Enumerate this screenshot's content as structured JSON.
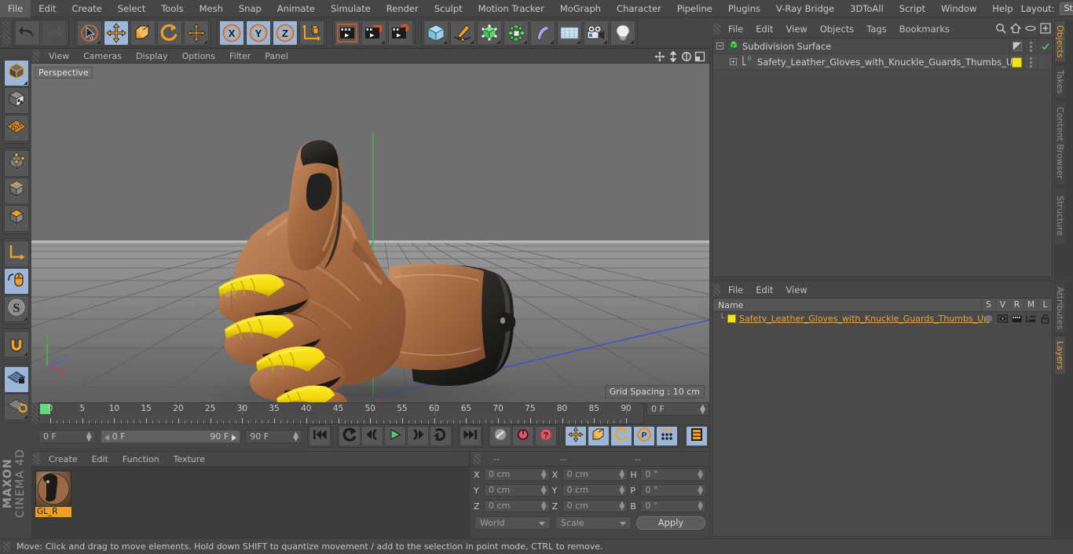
{
  "app": {
    "brand_top": "MAXON",
    "brand_bottom": "CINEMA 4D"
  },
  "menubar": {
    "items": [
      "File",
      "Edit",
      "Create",
      "Select",
      "Tools",
      "Mesh",
      "Snap",
      "Animate",
      "Simulate",
      "Render",
      "Sculpt",
      "Motion Tracker",
      "MoGraph",
      "Character",
      "Pipeline",
      "Plugins",
      "V-Ray Bridge",
      "3DToAll",
      "Script",
      "Window",
      "Help"
    ],
    "layout_label": "Layout:",
    "layout_value": "Startup",
    "search_icon": "magnifier-icon"
  },
  "toolbar": {
    "groups": [
      {
        "name": "history",
        "buttons": [
          {
            "icon": "undo-icon",
            "label": "Undo",
            "active": false,
            "disabled": false
          },
          {
            "icon": "redo-icon",
            "label": "Redo",
            "active": false,
            "disabled": true
          }
        ]
      },
      {
        "name": "transform",
        "buttons": [
          {
            "icon": "select-cursor-icon",
            "label": "Live Selection",
            "active": false
          },
          {
            "icon": "move-icon",
            "label": "Move",
            "active": true
          },
          {
            "icon": "scale-icon",
            "label": "Scale",
            "active": false
          },
          {
            "icon": "rotate-icon",
            "label": "Rotate",
            "active": false
          },
          {
            "icon": "move-dynamic-icon",
            "label": "Dynamic Place",
            "active": false
          }
        ]
      },
      {
        "name": "axis-locks",
        "buttons": [
          {
            "icon": "axis-x-icon",
            "label": "X",
            "active": true
          },
          {
            "icon": "axis-y-icon",
            "label": "Y",
            "active": true
          },
          {
            "icon": "axis-z-icon",
            "label": "Z",
            "active": true
          },
          {
            "icon": "world-object-axis-icon",
            "label": "World/Object",
            "active": false
          }
        ]
      },
      {
        "name": "render",
        "buttons": [
          {
            "icon": "render-view-icon",
            "label": "Render View",
            "active": false
          },
          {
            "icon": "render-picture-viewer-icon",
            "label": "Render to Picture Viewer",
            "active": false
          },
          {
            "icon": "render-settings-icon",
            "label": "Edit Render Settings",
            "active": false
          }
        ]
      },
      {
        "name": "create",
        "buttons": [
          {
            "icon": "cube-primitive-icon",
            "label": "Add Cube Object",
            "active": false
          },
          {
            "icon": "spline-pen-icon",
            "label": "Add Spline",
            "active": false
          },
          {
            "icon": "generator-icon",
            "label": "Add Generator",
            "active": false
          },
          {
            "icon": "mograph-icon",
            "label": "Add MoGraph",
            "active": false
          },
          {
            "icon": "deformer-icon",
            "label": "Add Deformer",
            "active": false
          },
          {
            "icon": "scene-environment-icon",
            "label": "Add Scene Object",
            "active": false
          },
          {
            "icon": "camera-icon",
            "label": "Add Camera",
            "active": false
          },
          {
            "icon": "light-bulb-icon",
            "label": "Add Light",
            "active": false
          }
        ]
      }
    ]
  },
  "left_toolbar": {
    "groups": [
      {
        "buttons": [
          {
            "icon": "editable-object-icon",
            "label": "Make Editable",
            "active": true
          },
          {
            "icon": "model-mode-icon",
            "label": "Model Mode",
            "active": false
          },
          {
            "icon": "texture-mode-icon",
            "label": "Texture Mode",
            "active": false
          }
        ]
      },
      {
        "buttons": [
          {
            "icon": "points-mode-icon",
            "label": "Points",
            "active": false
          },
          {
            "icon": "edges-mode-icon",
            "label": "Edges",
            "active": false
          },
          {
            "icon": "polygons-mode-icon",
            "label": "Polygons",
            "active": false
          }
        ]
      },
      {
        "buttons": [
          {
            "icon": "axis-modify-icon",
            "label": "Enable Axis Modification",
            "active": false
          },
          {
            "icon": "viewport-solo-icon",
            "label": "Viewport Solo",
            "active": true
          },
          {
            "icon": "soft-selection-icon",
            "label": "Soft Selection",
            "active": false
          }
        ]
      },
      {
        "buttons": [
          {
            "icon": "magnet-icon",
            "label": "Magnet",
            "active": false
          }
        ]
      },
      {
        "buttons": [
          {
            "icon": "workplane-lock-icon",
            "label": "Lock Workplane",
            "active": true
          },
          {
            "icon": "workplane-rotate-icon",
            "label": "Planar Workplane Rotation",
            "active": false
          }
        ]
      }
    ]
  },
  "viewport": {
    "menu": [
      "View",
      "Cameras",
      "Display",
      "Options",
      "Filter",
      "Panel"
    ],
    "nav_icons": [
      "move-camera-icon",
      "zoom-camera-icon",
      "rotate-camera-icon",
      "maximize-viewport-icon"
    ],
    "view_label": "Perspective",
    "grid_spacing": "Grid Spacing : 10 cm",
    "axis_gizmo": {
      "x": "X",
      "y": "Y",
      "z": "Z"
    }
  },
  "timeline": {
    "ticks": [
      {
        "v": "0",
        "f": 0
      },
      {
        "v": "5",
        "f": 5
      },
      {
        "v": "10",
        "f": 10
      },
      {
        "v": "15",
        "f": 15
      },
      {
        "v": "20",
        "f": 20
      },
      {
        "v": "25",
        "f": 25
      },
      {
        "v": "30",
        "f": 30
      },
      {
        "v": "35",
        "f": 35
      },
      {
        "v": "40",
        "f": 40
      },
      {
        "v": "45",
        "f": 45
      },
      {
        "v": "50",
        "f": 50
      },
      {
        "v": "55",
        "f": 55
      },
      {
        "v": "60",
        "f": 60
      },
      {
        "v": "65",
        "f": 65
      },
      {
        "v": "70",
        "f": 70
      },
      {
        "v": "75",
        "f": 75
      },
      {
        "v": "80",
        "f": 80
      },
      {
        "v": "85",
        "f": 85
      },
      {
        "v": "90",
        "f": 90
      }
    ],
    "current_frame_right": "0 F",
    "current_frame": "0 F",
    "range_start": "0 F",
    "range_end": "90 F",
    "max_frame": "90 F",
    "transport": [
      {
        "icon": "go-to-start-icon",
        "label": "Go to Start"
      },
      {
        "icon": "loop-icon",
        "label": "Play Mode / Loop"
      },
      {
        "icon": "step-back-icon",
        "label": "Previous Frame"
      },
      {
        "icon": "play-icon",
        "label": "Play Forward"
      },
      {
        "icon": "step-forward-icon",
        "label": "Next Frame"
      },
      {
        "icon": "goto-next-key-icon",
        "label": "Go to Next Key"
      },
      {
        "icon": "go-to-end-icon",
        "label": "Go to End"
      }
    ],
    "keyframe_tools": [
      {
        "icon": "record-key-grey-icon",
        "label": "Record Active Objects",
        "active": false
      },
      {
        "icon": "autokey-icon",
        "label": "Autokeying",
        "active": false
      },
      {
        "icon": "keyframe-selection-icon",
        "label": "Keyframe Selection",
        "active": false
      }
    ],
    "key_channels": [
      {
        "icon": "position-key-icon",
        "label": "Position",
        "active": true
      },
      {
        "icon": "scale-key-icon",
        "label": "Scale",
        "active": true
      },
      {
        "icon": "rotation-key-icon",
        "label": "Rotation",
        "active": true
      },
      {
        "icon": "param-key-icon",
        "label": "Parameter",
        "active": true
      },
      {
        "icon": "pla-key-icon",
        "label": "Point Level Animation",
        "active": true
      }
    ],
    "timeline_toggle": {
      "icon": "timeline-icon",
      "label": "Animate Mode",
      "active": true
    }
  },
  "materials": {
    "menu": [
      "Create",
      "Edit",
      "Function",
      "Texture"
    ],
    "items": [
      {
        "name": "GL_R",
        "selected": true
      }
    ]
  },
  "coordinates": {
    "header": [
      "--",
      "--",
      "--"
    ],
    "rows": [
      {
        "pos_label": "X",
        "pos_value": "0 cm",
        "size_label": "X",
        "size_value": "0 cm",
        "rot_label": "H",
        "rot_value": "0 °"
      },
      {
        "pos_label": "Y",
        "pos_value": "0 cm",
        "size_label": "Y",
        "size_value": "0 cm",
        "rot_label": "P",
        "rot_value": "0 °"
      },
      {
        "pos_label": "Z",
        "pos_value": "0 cm",
        "size_label": "Z",
        "size_value": "0 cm",
        "rot_label": "B",
        "rot_value": "0 °"
      }
    ],
    "space_select": "World",
    "mode_select": "Scale",
    "apply_label": "Apply"
  },
  "object_manager": {
    "menu": [
      "File",
      "Edit",
      "View",
      "Objects",
      "Tags",
      "Bookmarks"
    ],
    "icons": [
      "search-icon",
      "home-icon",
      "eye-icon",
      "expand-icon"
    ],
    "rows": [
      {
        "name": "Subdivision Surface",
        "icon": "subdivision-surface-icon",
        "indent": 0,
        "expander": "minus",
        "tag_swatch": "gradient",
        "checked": true
      },
      {
        "name": "Safety_Leather_Gloves_with_Knuckle_Guards_Thumbs_Up",
        "icon": "polygon-object-icon",
        "indent": 1,
        "expander": "plus",
        "tag_swatch": "#f2e11c",
        "checked": false
      }
    ]
  },
  "layer_manager": {
    "menu": [
      "File",
      "Edit",
      "View"
    ],
    "columns": [
      "Name",
      "S",
      "V",
      "R",
      "M",
      "L"
    ],
    "rows": [
      {
        "name": "Safety_Leather_Gloves_with_Knuckle_Guards_Thumbs_Up",
        "color": "#f2e11c",
        "s": "solo-dot-icon",
        "v": "eye-icon",
        "r": "render-icon",
        "m": "manager-icon",
        "l": "lock-open-icon"
      }
    ]
  },
  "right_tabs_top": [
    "Objects",
    "Takes",
    "Content Browser",
    "Structure"
  ],
  "right_tabs_bottom": [
    "Attributes",
    "Layers"
  ],
  "right_tabs_active_top": "Objects",
  "right_tabs_active_bottom": "Layers",
  "status_bar": {
    "text": "Move: Click and drag to move elements. Hold down SHIFT to quantize movement / add to the selection in point mode, CTRL to remove."
  },
  "colors": {
    "accent_orange": "#e8a23a",
    "selected_blue": "#9bb6d8",
    "panel_bg": "#464646",
    "list_bg": "#4a4a4a",
    "material_yellow": "#f2e11c"
  }
}
